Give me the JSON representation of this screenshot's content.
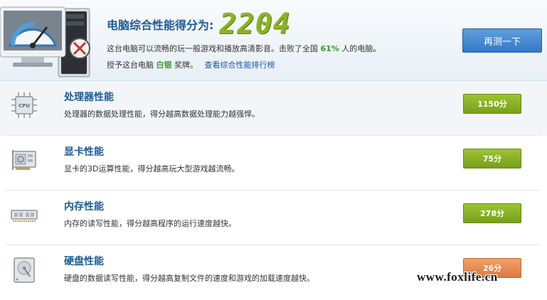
{
  "header": {
    "score_label": "电脑综合性能得分为:",
    "score_value": "2204",
    "desc_prefix": "这台电脑可以流畅的玩一般游戏和播放高清影音。击败了全国",
    "percent": "61%",
    "desc_suffix": "人的电脑。",
    "award_prefix": "授予这台电脑",
    "award_name": "白银",
    "award_suffix": "奖牌。",
    "rank_link": "查看综合性能排行榜",
    "retest_button": "再测一下",
    "accent_color": "#8bb321"
  },
  "rows": [
    {
      "title": "处理器性能",
      "desc": "处理器的数据处理性能，得分越高数据处理能力越强悍。",
      "score": "1150分",
      "icon": "cpu-icon",
      "icon_text": "CPU",
      "badge_color": "#8bb321"
    },
    {
      "title": "显卡性能",
      "desc": "显卡的3D运算性能，得分越高玩大型游戏越流畅。",
      "score": "75分",
      "icon": "graphics-card-icon",
      "badge_color": "#8bb321"
    },
    {
      "title": "内存性能",
      "desc": "内存的读写性能，得分越高程序的运行速度越快。",
      "score": "278分",
      "icon": "memory-icon",
      "badge_color": "#8bb321"
    },
    {
      "title": "硬盘性能",
      "desc": "硬盘的数据读写性能，得分越高复制文件的速度和游戏的加载速度越快。",
      "score": "26分",
      "icon": "hard-disk-icon",
      "badge_color": "#e08445"
    }
  ],
  "watermark": "www.foxlife.cn"
}
